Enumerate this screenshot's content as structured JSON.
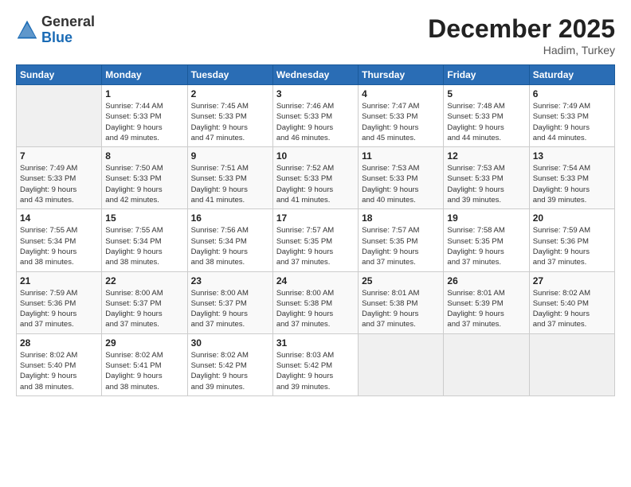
{
  "header": {
    "logo_general": "General",
    "logo_blue": "Blue",
    "month_year": "December 2025",
    "location": "Hadim, Turkey"
  },
  "days_of_week": [
    "Sunday",
    "Monday",
    "Tuesday",
    "Wednesday",
    "Thursday",
    "Friday",
    "Saturday"
  ],
  "weeks": [
    [
      {
        "day": "",
        "info": ""
      },
      {
        "day": "1",
        "info": "Sunrise: 7:44 AM\nSunset: 5:33 PM\nDaylight: 9 hours\nand 49 minutes."
      },
      {
        "day": "2",
        "info": "Sunrise: 7:45 AM\nSunset: 5:33 PM\nDaylight: 9 hours\nand 47 minutes."
      },
      {
        "day": "3",
        "info": "Sunrise: 7:46 AM\nSunset: 5:33 PM\nDaylight: 9 hours\nand 46 minutes."
      },
      {
        "day": "4",
        "info": "Sunrise: 7:47 AM\nSunset: 5:33 PM\nDaylight: 9 hours\nand 45 minutes."
      },
      {
        "day": "5",
        "info": "Sunrise: 7:48 AM\nSunset: 5:33 PM\nDaylight: 9 hours\nand 44 minutes."
      },
      {
        "day": "6",
        "info": "Sunrise: 7:49 AM\nSunset: 5:33 PM\nDaylight: 9 hours\nand 44 minutes."
      }
    ],
    [
      {
        "day": "7",
        "info": "Sunrise: 7:49 AM\nSunset: 5:33 PM\nDaylight: 9 hours\nand 43 minutes."
      },
      {
        "day": "8",
        "info": "Sunrise: 7:50 AM\nSunset: 5:33 PM\nDaylight: 9 hours\nand 42 minutes."
      },
      {
        "day": "9",
        "info": "Sunrise: 7:51 AM\nSunset: 5:33 PM\nDaylight: 9 hours\nand 41 minutes."
      },
      {
        "day": "10",
        "info": "Sunrise: 7:52 AM\nSunset: 5:33 PM\nDaylight: 9 hours\nand 41 minutes."
      },
      {
        "day": "11",
        "info": "Sunrise: 7:53 AM\nSunset: 5:33 PM\nDaylight: 9 hours\nand 40 minutes."
      },
      {
        "day": "12",
        "info": "Sunrise: 7:53 AM\nSunset: 5:33 PM\nDaylight: 9 hours\nand 39 minutes."
      },
      {
        "day": "13",
        "info": "Sunrise: 7:54 AM\nSunset: 5:33 PM\nDaylight: 9 hours\nand 39 minutes."
      }
    ],
    [
      {
        "day": "14",
        "info": "Sunrise: 7:55 AM\nSunset: 5:34 PM\nDaylight: 9 hours\nand 38 minutes."
      },
      {
        "day": "15",
        "info": "Sunrise: 7:55 AM\nSunset: 5:34 PM\nDaylight: 9 hours\nand 38 minutes."
      },
      {
        "day": "16",
        "info": "Sunrise: 7:56 AM\nSunset: 5:34 PM\nDaylight: 9 hours\nand 38 minutes."
      },
      {
        "day": "17",
        "info": "Sunrise: 7:57 AM\nSunset: 5:35 PM\nDaylight: 9 hours\nand 37 minutes."
      },
      {
        "day": "18",
        "info": "Sunrise: 7:57 AM\nSunset: 5:35 PM\nDaylight: 9 hours\nand 37 minutes."
      },
      {
        "day": "19",
        "info": "Sunrise: 7:58 AM\nSunset: 5:35 PM\nDaylight: 9 hours\nand 37 minutes."
      },
      {
        "day": "20",
        "info": "Sunrise: 7:59 AM\nSunset: 5:36 PM\nDaylight: 9 hours\nand 37 minutes."
      }
    ],
    [
      {
        "day": "21",
        "info": "Sunrise: 7:59 AM\nSunset: 5:36 PM\nDaylight: 9 hours\nand 37 minutes."
      },
      {
        "day": "22",
        "info": "Sunrise: 8:00 AM\nSunset: 5:37 PM\nDaylight: 9 hours\nand 37 minutes."
      },
      {
        "day": "23",
        "info": "Sunrise: 8:00 AM\nSunset: 5:37 PM\nDaylight: 9 hours\nand 37 minutes."
      },
      {
        "day": "24",
        "info": "Sunrise: 8:00 AM\nSunset: 5:38 PM\nDaylight: 9 hours\nand 37 minutes."
      },
      {
        "day": "25",
        "info": "Sunrise: 8:01 AM\nSunset: 5:38 PM\nDaylight: 9 hours\nand 37 minutes."
      },
      {
        "day": "26",
        "info": "Sunrise: 8:01 AM\nSunset: 5:39 PM\nDaylight: 9 hours\nand 37 minutes."
      },
      {
        "day": "27",
        "info": "Sunrise: 8:02 AM\nSunset: 5:40 PM\nDaylight: 9 hours\nand 37 minutes."
      }
    ],
    [
      {
        "day": "28",
        "info": "Sunrise: 8:02 AM\nSunset: 5:40 PM\nDaylight: 9 hours\nand 38 minutes."
      },
      {
        "day": "29",
        "info": "Sunrise: 8:02 AM\nSunset: 5:41 PM\nDaylight: 9 hours\nand 38 minutes."
      },
      {
        "day": "30",
        "info": "Sunrise: 8:02 AM\nSunset: 5:42 PM\nDaylight: 9 hours\nand 39 minutes."
      },
      {
        "day": "31",
        "info": "Sunrise: 8:03 AM\nSunset: 5:42 PM\nDaylight: 9 hours\nand 39 minutes."
      },
      {
        "day": "",
        "info": ""
      },
      {
        "day": "",
        "info": ""
      },
      {
        "day": "",
        "info": ""
      }
    ]
  ]
}
